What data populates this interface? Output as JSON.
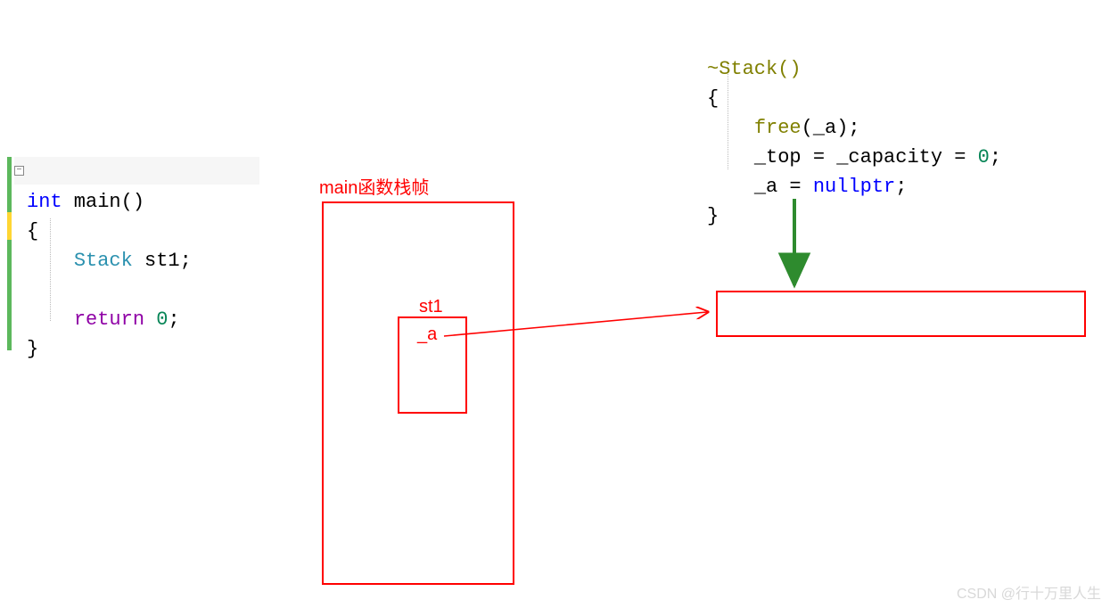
{
  "code_left": {
    "l1_int": "int",
    "l1_main": " main()",
    "l2_brace": "{",
    "l3_indent": "    ",
    "l3_stack": "Stack",
    "l3_st1": " st1;",
    "l5_indent": "    ",
    "l5_return": "return",
    "l5_zero": " 0",
    "l5_semi": ";",
    "l6_brace": "}"
  },
  "code_right": {
    "r1_tilde": "~Stack()",
    "r2_brace": "{",
    "r3_indent": "    ",
    "r3_free": "free",
    "r3_arg": "(_a);",
    "r4_indent": "    ",
    "r4_top": "_top = _capacity = ",
    "r4_zero": "0",
    "r4_semi": ";",
    "r5_indent": "    ",
    "r5_a": "_a = ",
    "r5_nullptr": "nullptr",
    "r5_semi": ";",
    "r6_brace": "}"
  },
  "labels": {
    "main_frame": "main函数栈帧",
    "st1": "st1",
    "heap_var": "_a"
  },
  "collapse_glyph": "−",
  "watermark": "CSDN @行十万里人生"
}
